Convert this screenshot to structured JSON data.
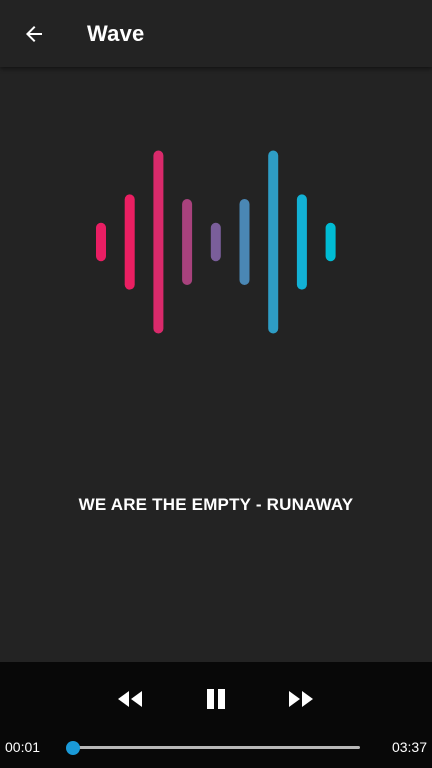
{
  "appbar": {
    "back_icon": "arrow-back-icon",
    "title": "Wave"
  },
  "visualizer": {
    "bar_levels": [
      0.21,
      0.52,
      1.0,
      0.47,
      0.21,
      0.47,
      1.0,
      0.52,
      0.21
    ],
    "bar_colors": [
      "#e91e63",
      "#ea1f62",
      "#d92a6b",
      "#a8427d",
      "#7a5e9a",
      "#4a87b4",
      "#2e9dc5",
      "#12b1d5",
      "#00bcd4"
    ]
  },
  "track": {
    "title": "WE ARE THE EMPTY - RUNAWAY"
  },
  "player": {
    "rewind_icon": "rewind-icon",
    "pause_icon": "pause-icon",
    "forward_icon": "fast-forward-icon",
    "current_time": "00:01",
    "total_time": "03:37",
    "progress": 0.0,
    "accent_color": "#1a9ad8"
  }
}
